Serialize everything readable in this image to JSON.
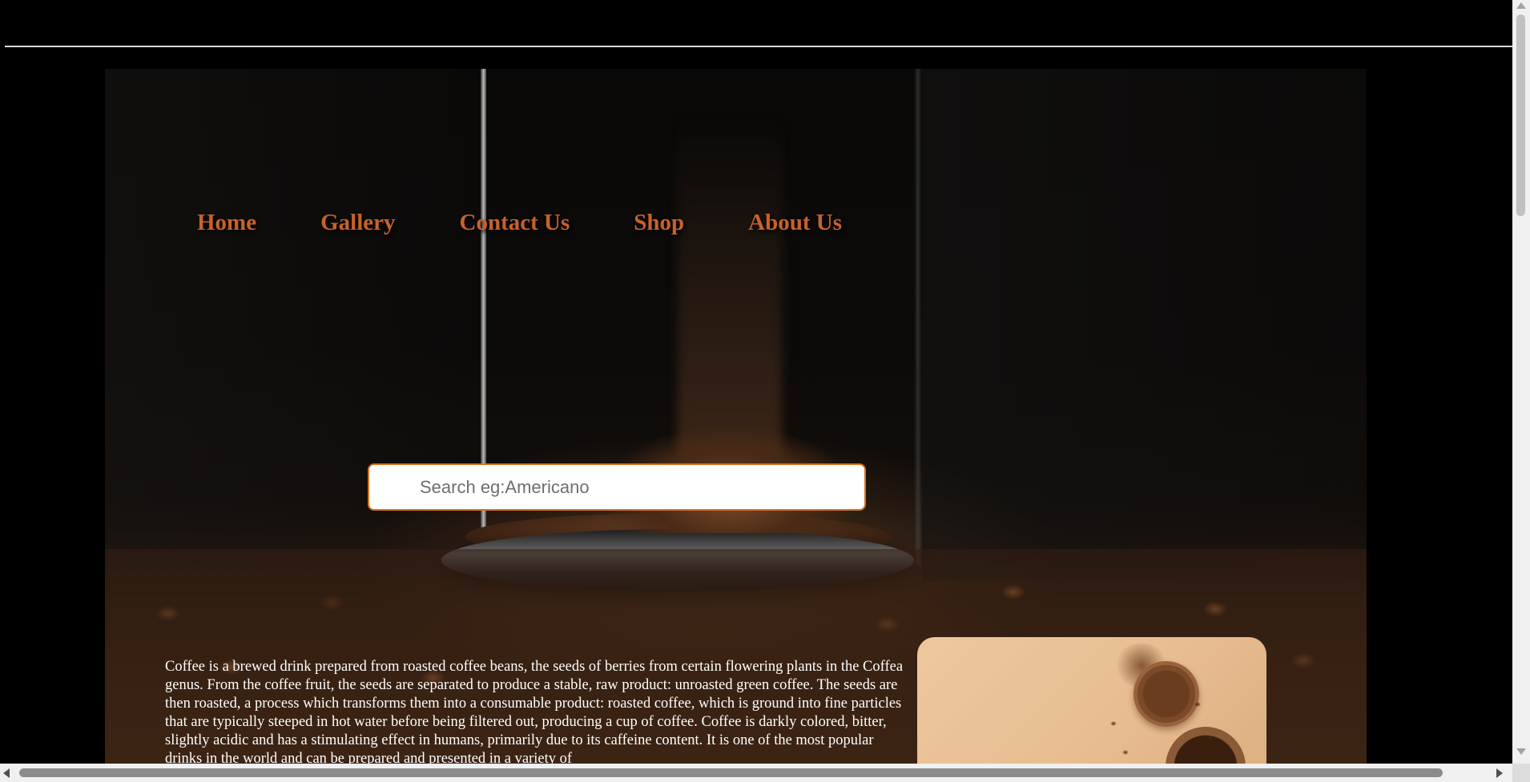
{
  "nav": {
    "items": [
      {
        "label": "Home"
      },
      {
        "label": "Gallery"
      },
      {
        "label": "Contact Us"
      },
      {
        "label": "Shop"
      },
      {
        "label": "About Us"
      }
    ]
  },
  "search": {
    "placeholder": "Search eg:Americano",
    "value": ""
  },
  "intro": {
    "text": "Coffee is a brewed drink prepared from roasted coffee beans, the seeds of berries from certain flowering plants in the Coffea genus. From the coffee fruit, the seeds are separated to produce a stable, raw product: unroasted green coffee. The seeds are then roasted, a process which transforms them into a consumable product: roasted coffee, which is ground into fine particles that are typically steeped in hot water before being filtered out, producing a cup of coffee. Coffee is darkly colored, bitter, slightly acidic and has a stimulating effect in humans, primarily due to its caffeine content. It is one of the most popular drinks in the world and can be prepared and presented in a variety of"
  },
  "colors": {
    "nav_link": "#c8622a",
    "search_border": "#d6731f",
    "page_background": "#000000",
    "card_background": "#eec79f"
  },
  "icons": {
    "hero": "coffee-grinder-hero-image",
    "card": "coffee-bowls-image"
  }
}
